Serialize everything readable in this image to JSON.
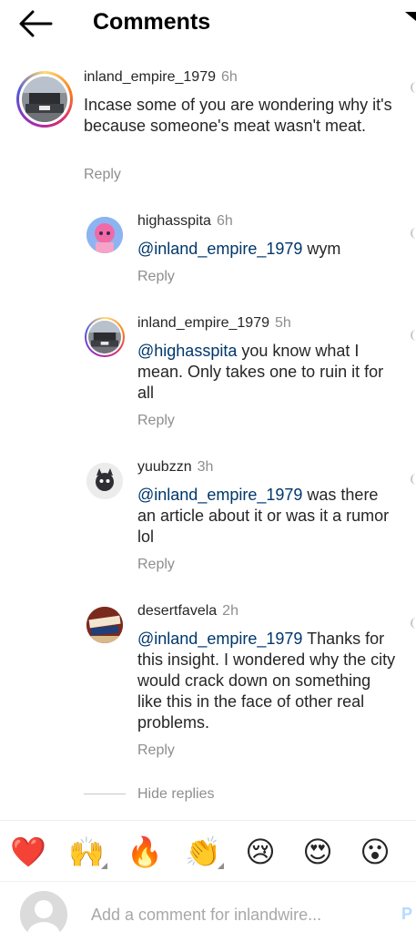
{
  "header": {
    "title": "Comments"
  },
  "comments": [
    {
      "username": "inland_empire_1979",
      "time": "6h",
      "text": "Incase some of you are wondering why it's because someone's meat wasn't meat.",
      "reply": "Reply"
    },
    {
      "username": "highasspita",
      "time": "6h",
      "mention": "@inland_empire_1979",
      "text": " wym",
      "reply": "Reply"
    },
    {
      "username": "inland_empire_1979",
      "time": "5h",
      "mention": "@highasspita",
      "text": " you know what I mean. Only takes one to ruin it for all",
      "reply": "Reply"
    },
    {
      "username": "yuubzzn",
      "time": "3h",
      "mention": "@inland_empire_1979",
      "text": " was there an article about it or was it a rumor lol",
      "reply": "Reply"
    },
    {
      "username": "desertfavela",
      "time": "2h",
      "mention": "@inland_empire_1979",
      "text": " Thanks for this insight. I wondered why the city would crack down on something like this in the face of other real problems.",
      "reply": "Reply"
    }
  ],
  "hide_replies": "Hide replies",
  "emoji_bar": [
    {
      "glyph": "❤️",
      "name": "red-heart"
    },
    {
      "glyph": "🙌",
      "name": "raising-hands"
    },
    {
      "glyph": "🔥",
      "name": "fire"
    },
    {
      "glyph": "👏",
      "name": "clapping-hands"
    },
    {
      "glyph": "😢",
      "name": "crying-face"
    },
    {
      "glyph": "😍",
      "name": "heart-eyes"
    },
    {
      "glyph": "😮",
      "name": "open-mouth-face"
    }
  ],
  "composer": {
    "placeholder": "Add a comment for inlandwire...",
    "post_label": "P"
  },
  "colors": {
    "mention": "#00376b",
    "muted": "#8e8e8e",
    "post": "#b3dbff"
  }
}
